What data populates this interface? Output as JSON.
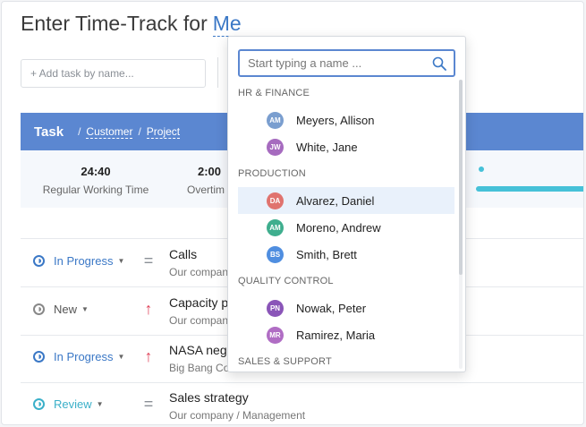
{
  "header": {
    "title": "Enter Time-Track for",
    "who": "Me"
  },
  "add_task": {
    "placeholder": "+ Add task by name..."
  },
  "table_header": {
    "task": "Task",
    "customer": "Customer",
    "project": "Project",
    "sep": "/"
  },
  "stats": [
    {
      "value": "24:40",
      "label": "Regular Working Time"
    },
    {
      "value": "2:00",
      "label": "Overtim"
    }
  ],
  "tasks": [
    {
      "status": "In Progress",
      "status_kind": "in-progress",
      "priority": "equal",
      "name": "Calls",
      "sub": "Our company"
    },
    {
      "status": "New",
      "status_kind": "new",
      "priority": "up",
      "name": "Capacity p",
      "sub": "Our company"
    },
    {
      "status": "In Progress",
      "status_kind": "in-progress",
      "priority": "up",
      "name": "NASA neg",
      "sub": "Big Bang Co"
    },
    {
      "status": "Review",
      "status_kind": "review",
      "priority": "equal",
      "name": "Sales strategy",
      "sub": "Our company / Management"
    }
  ],
  "dropdown": {
    "search_placeholder": "Start typing a name ...",
    "groups": [
      {
        "label": "HR & FINANCE",
        "people": [
          {
            "initials": "AM",
            "name": "Meyers, Allison",
            "color": "#7a9ecf"
          },
          {
            "initials": "JW",
            "name": "White, Jane",
            "color": "#a66bbf"
          }
        ]
      },
      {
        "label": "PRODUCTION",
        "people": [
          {
            "initials": "DA",
            "name": "Alvarez, Daniel",
            "color": "#e0736e"
          },
          {
            "initials": "AM",
            "name": "Moreno, Andrew",
            "color": "#3fae8e"
          },
          {
            "initials": "BS",
            "name": "Smith, Brett",
            "color": "#4f8ee0"
          }
        ]
      },
      {
        "label": "QUALITY CONTROL",
        "people": [
          {
            "initials": "PN",
            "name": "Nowak, Peter",
            "color": "#8a55b8"
          },
          {
            "initials": "MR",
            "name": "Ramirez, Maria",
            "color": "#b06dc4"
          }
        ]
      },
      {
        "label": "SALES & SUPPORT",
        "people": []
      }
    ]
  },
  "colors": {
    "accent": "#5b87d1",
    "link": "#3b78c6",
    "progress": "#46c1d8",
    "priority_up": "#e0455c"
  }
}
